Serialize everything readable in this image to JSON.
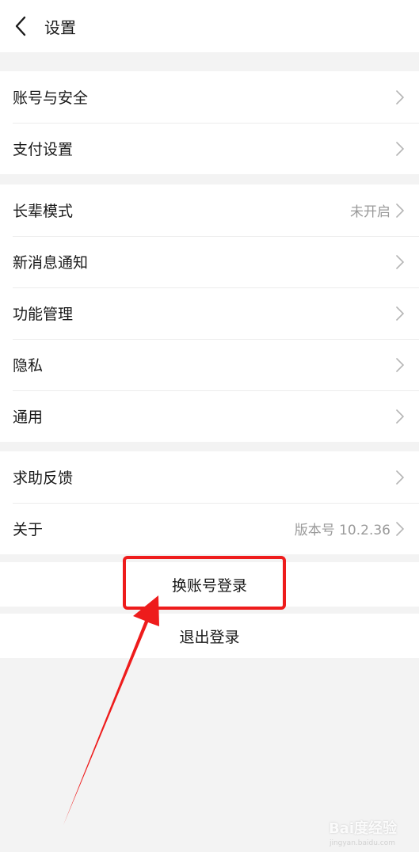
{
  "header": {
    "title": "设置",
    "back_icon": "chevron-left-icon"
  },
  "groups": [
    {
      "items": [
        {
          "label": "账号与安全",
          "value": ""
        },
        {
          "label": "支付设置",
          "value": ""
        }
      ]
    },
    {
      "items": [
        {
          "label": "长辈模式",
          "value": "未开启"
        },
        {
          "label": "新消息通知",
          "value": ""
        },
        {
          "label": "功能管理",
          "value": ""
        },
        {
          "label": "隐私",
          "value": ""
        },
        {
          "label": "通用",
          "value": ""
        }
      ]
    },
    {
      "items": [
        {
          "label": "求助反馈",
          "value": ""
        },
        {
          "label": "关于",
          "value": "版本号 10.2.36"
        }
      ]
    }
  ],
  "actions": {
    "switch_account": "换账号登录",
    "logout": "退出登录"
  },
  "annotation": {
    "color": "#ee1c1c"
  },
  "watermark": {
    "text": "Bai度经验",
    "sub": "jingyan.baidu.com"
  }
}
